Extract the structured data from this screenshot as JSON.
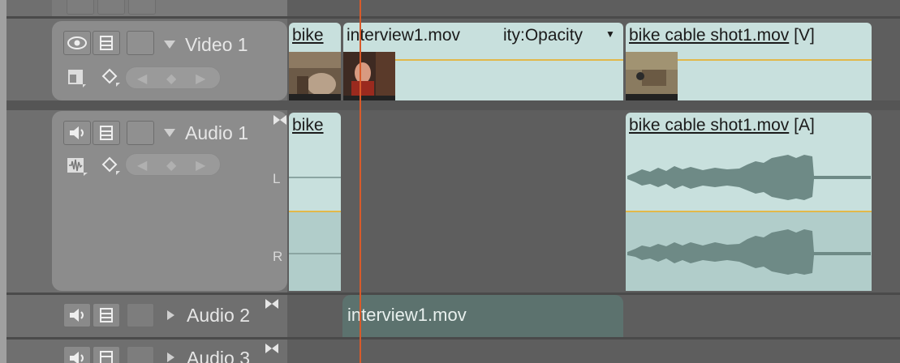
{
  "tracks": {
    "video1": {
      "name": "Video 1"
    },
    "audio1": {
      "name": "Audio 1",
      "left_label": "L",
      "right_label": "R"
    },
    "audio2": {
      "name": "Audio 2"
    },
    "audio3": {
      "name": "Audio 3"
    }
  },
  "clips": {
    "v_bike_short": {
      "title": "bike"
    },
    "v_interview": {
      "title": "interview1.mov"
    },
    "v_opacity_menu": {
      "label": "ity:Opacity"
    },
    "v_bike_cable": {
      "title": "bike cable shot1.mov",
      "suffix": "[V]"
    },
    "a_bike_short": {
      "title": "bike"
    },
    "a_bike_cable": {
      "title": "bike cable shot1.mov",
      "suffix": "[A]"
    },
    "a2_interview": {
      "title": "interview1.mov"
    }
  },
  "colors": {
    "clip_fill": "#c8e0dd",
    "selected_clip_fill": "#5c726e",
    "playhead": "#d85a2a",
    "opacity_line": "#e2b84a"
  }
}
